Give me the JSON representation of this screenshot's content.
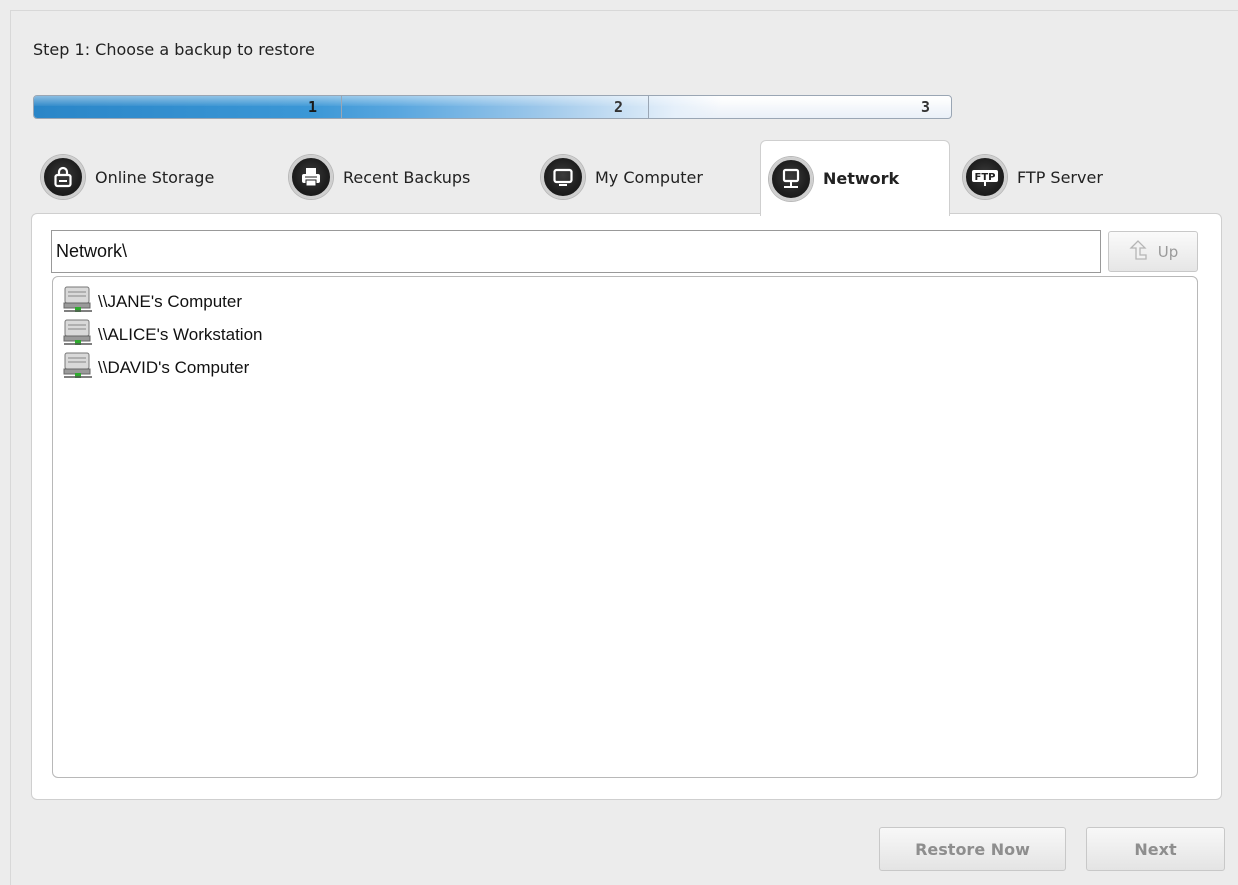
{
  "step_title": "Step 1: Choose a backup to restore",
  "progress": {
    "steps": [
      "1",
      "2",
      "3"
    ],
    "current_step": 1
  },
  "tabs": [
    {
      "label": "Online Storage",
      "icon": "lock-icon",
      "active": false
    },
    {
      "label": "Recent Backups",
      "icon": "printer-icon",
      "active": false
    },
    {
      "label": "My Computer",
      "icon": "monitor-icon",
      "active": false
    },
    {
      "label": "Network",
      "icon": "network-computer-icon",
      "active": true
    },
    {
      "label": "FTP Server",
      "icon": "ftp-icon",
      "active": false
    }
  ],
  "path": {
    "value": "Network\\"
  },
  "up_button": {
    "label": "Up"
  },
  "network_items": [
    {
      "label": "\\\\JANE's Computer",
      "icon": "network-drive-icon"
    },
    {
      "label": "\\\\ALICE's Workstation",
      "icon": "network-drive-icon"
    },
    {
      "label": "\\\\DAVID's Computer",
      "icon": "network-drive-icon"
    }
  ],
  "buttons": {
    "restore_now": "Restore Now",
    "next": "Next"
  },
  "colors": {
    "progress_fill": "#2a86c8",
    "disabled_text": "#8e8e8e"
  }
}
